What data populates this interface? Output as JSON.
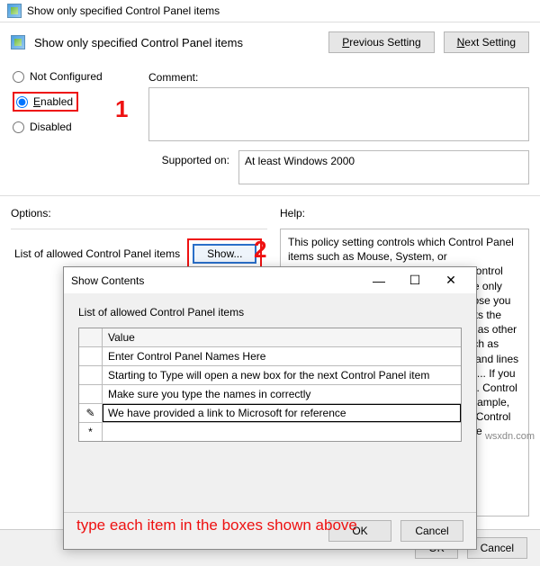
{
  "window": {
    "title": "Show only specified Control Panel items",
    "header_title": "Show only specified Control Panel items"
  },
  "nav": {
    "previous": "Previous Setting",
    "next": "Next Setting"
  },
  "radios": {
    "not_configured": "Not Configured",
    "enabled": "Enabled",
    "disabled": "Disabled"
  },
  "labels": {
    "comment": "Comment:",
    "supported_on": "Supported on:",
    "options": "Options:",
    "help": "Help:",
    "option_item": "List of allowed Control Panel items",
    "show_button": "Show..."
  },
  "supported_text": "At least Windows 2000",
  "help_text": "This policy setting controls which Control Panel items such as Mouse, System, or Personalization, are displayed on the Control Panel window and the Start screen. The only items displayed in Control Panel are those you specify in this setting. This setting affects the Start screen and Control Panel, as well as other ways to access Control Panel items such as shortcuts in Help and Support or command lines that use control.exe. This policy setting ...\n\nIf you enable this setting, ...\n\n... policy setting ... Control Panel items ... canonical name ... for example, enter ...\n\n... and each ... example ... of a Control Panel item's canonical name ... resource identifier ...",
  "modal": {
    "title": "Show Contents",
    "list_label": "List of allowed Control Panel items",
    "header": "Value",
    "rows": [
      "Enter Control Panel Names Here",
      "Starting to Type will open a new box for the next Control Panel item",
      "Make sure you type the names in correctly",
      "We have provided a link to Microsoft for reference"
    ],
    "edit_marker": "✎",
    "new_marker": "*",
    "ok": "OK",
    "cancel": "Cancel"
  },
  "main_buttons": {
    "ok": "OK",
    "cancel": "Cancel"
  },
  "annotations": {
    "one": "1",
    "two": "2",
    "hint": "type each item in the boxes shown above"
  },
  "watermark": "wsxdn.com"
}
